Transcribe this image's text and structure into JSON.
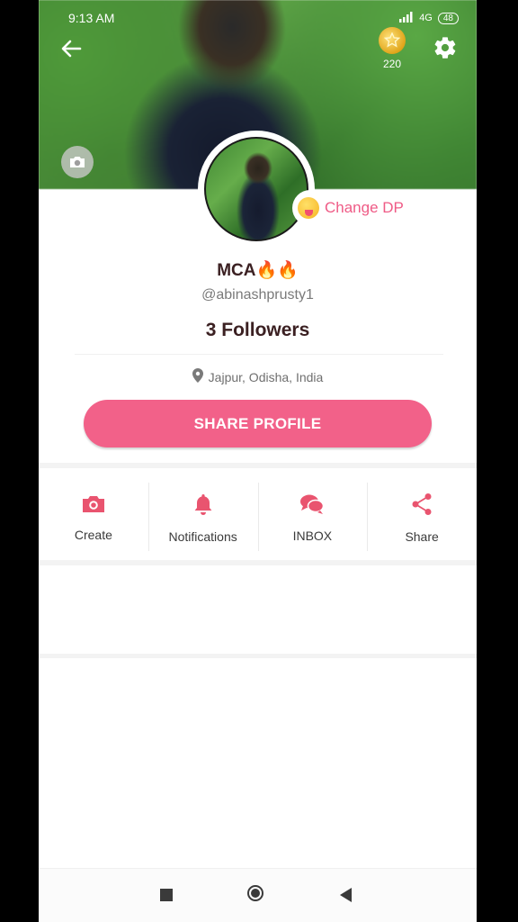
{
  "status_bar": {
    "time": "9:13 AM",
    "network": "4G",
    "battery": "48"
  },
  "header": {
    "coins": "220"
  },
  "profile": {
    "change_dp_label": "Change DP",
    "name": "MCA🔥🔥",
    "handle": "@abinashprusty1",
    "followers": "3 Followers",
    "location": "Jajpur, Odisha, India",
    "share_profile_label": "SHARE PROFILE"
  },
  "actions": [
    {
      "label": "Create",
      "icon": "camera-icon"
    },
    {
      "label": "Notifications",
      "icon": "bell-icon"
    },
    {
      "label": "INBOX",
      "icon": "chat-bubbles-icon"
    },
    {
      "label": "Share",
      "icon": "share-icon"
    }
  ],
  "colors": {
    "accent": "#f26189",
    "icon_accent": "#e9546f",
    "text_dark": "#3b2022"
  }
}
